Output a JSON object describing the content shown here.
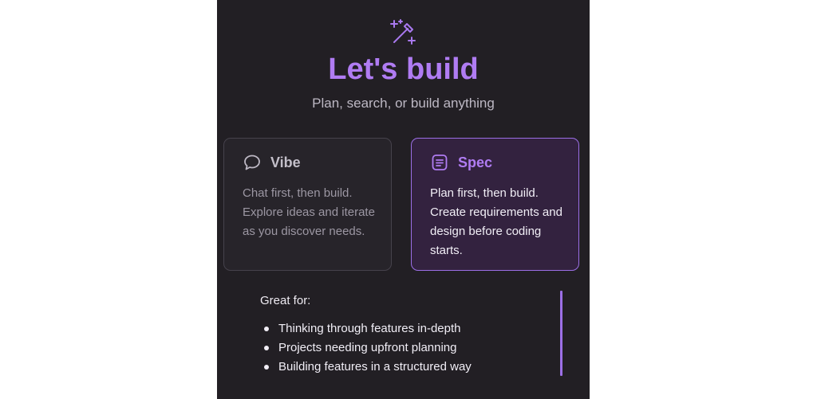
{
  "header": {
    "icon": "magic-wand-icon",
    "title": "Let's build",
    "subtitle": "Plan, search, or build anything"
  },
  "modes": [
    {
      "icon": "chat-bubble-icon",
      "title": "Vibe",
      "description": "Chat first, then build. Explore ideas and iterate as you discover needs.",
      "selected": false
    },
    {
      "icon": "document-icon",
      "title": "Spec",
      "description": "Plan first, then build. Create requirements and design before coding starts.",
      "selected": true
    }
  ],
  "details": {
    "heading": "Great for:",
    "items": [
      "Thinking through features in-depth",
      "Projects needing upfront planning",
      "Building features in a structured way"
    ]
  },
  "colors": {
    "background": "#221f24",
    "accent": "#b07cf3",
    "selected_border": "#9c6fe6",
    "selected_fill": "#33223f"
  }
}
